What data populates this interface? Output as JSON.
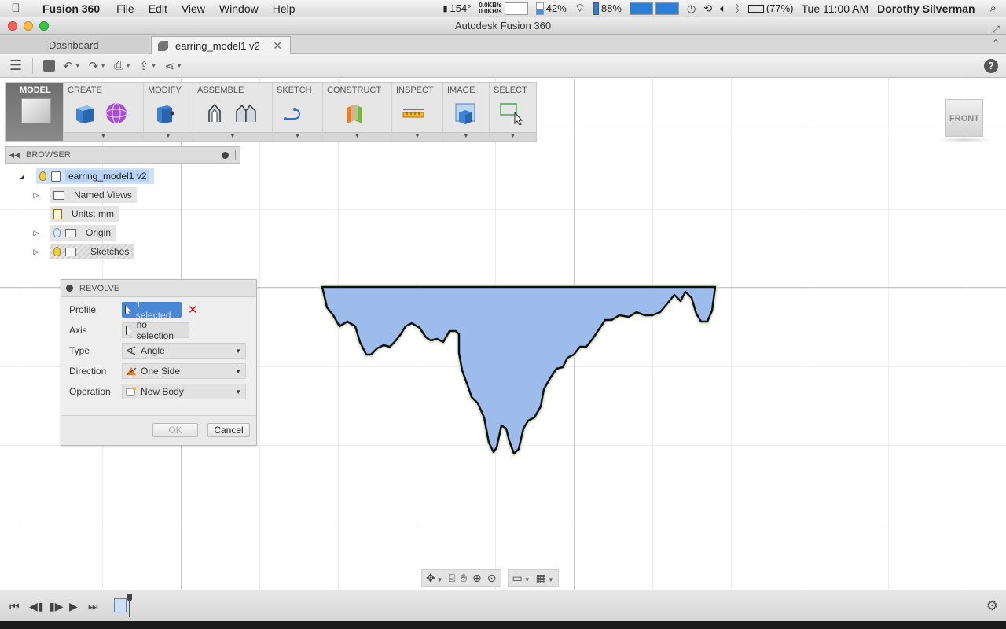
{
  "menubar": {
    "app_name": "Fusion 360",
    "menus": [
      "File",
      "Edit",
      "View",
      "Window",
      "Help"
    ],
    "temperature": "154°",
    "net_up": "0.0KB/s",
    "net_down": "0.0KB/s",
    "cpu": "42%",
    "battery_level": "88%",
    "power": "(77%)",
    "clock": "Tue 11:00 AM",
    "user": "Dorothy Silverman"
  },
  "window": {
    "title": "Autodesk Fusion 360"
  },
  "tabs": {
    "dashboard": "Dashboard",
    "document": "earring_model1 v2",
    "close_glyph": "✕"
  },
  "qat": {
    "menu_glyph": "☰"
  },
  "ribbon": {
    "workspace": "MODEL",
    "groups": [
      "CREATE",
      "MODIFY",
      "ASSEMBLE",
      "SKETCH",
      "CONSTRUCT",
      "INSPECT",
      "IMAGE",
      "SELECT"
    ]
  },
  "viewcube": {
    "face": "FRONT"
  },
  "browser": {
    "title": "BROWSER",
    "root": "earring_model1 v2",
    "items": {
      "named_views": "Named Views",
      "units": "Units: mm",
      "origin": "Origin",
      "sketches": "Sketches"
    }
  },
  "revolve": {
    "title": "REVOLVE",
    "profile_label": "Profile",
    "profile_value": "1 selected",
    "axis_label": "Axis",
    "axis_value": "no selection",
    "type_label": "Type",
    "type_value": "Angle",
    "direction_label": "Direction",
    "direction_value": "One Side",
    "operation_label": "Operation",
    "operation_value": "New Body",
    "ok": "OK",
    "cancel": "Cancel"
  },
  "colors": {
    "profile_fill": "#9dbcec",
    "selection_blue": "#4a88d6",
    "remove_red": "#c21a1a"
  }
}
